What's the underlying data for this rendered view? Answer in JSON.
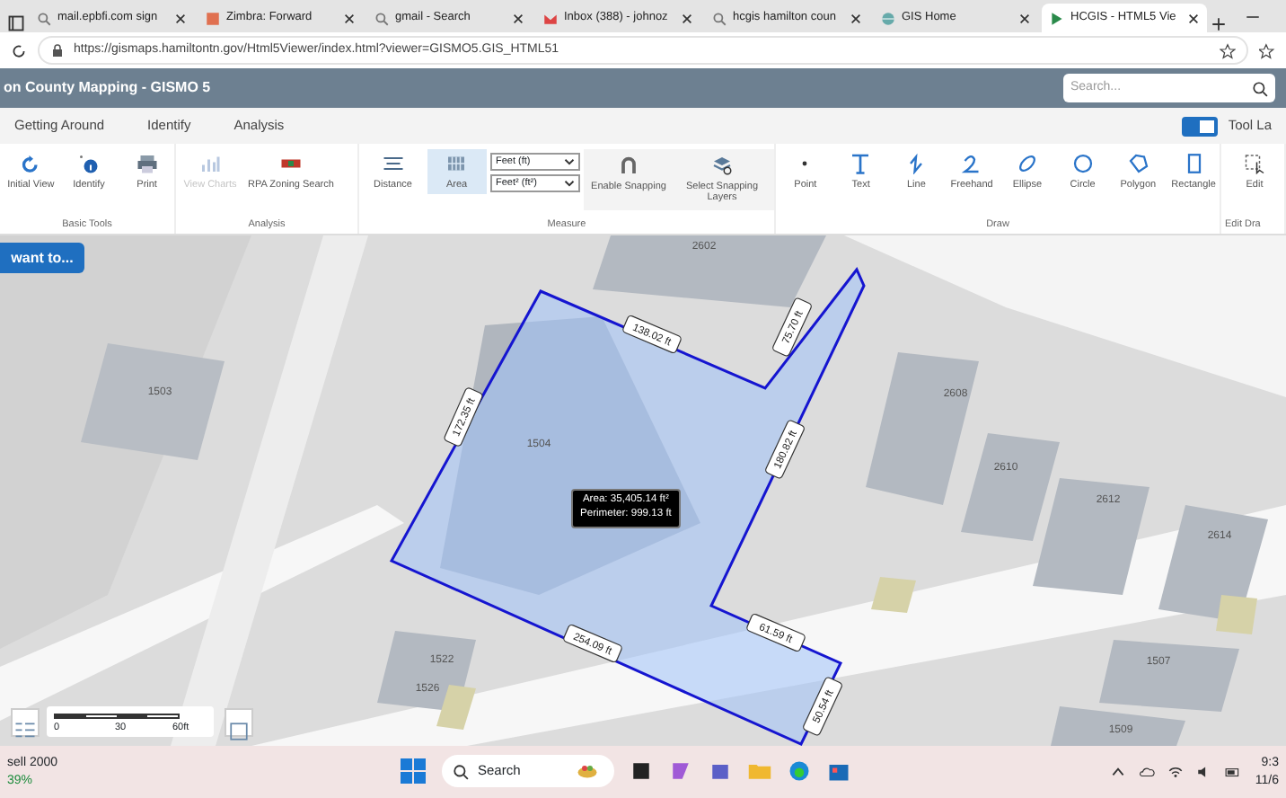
{
  "browser": {
    "tabs": [
      {
        "title": "mail.epbfi.com sign",
        "selected": false
      },
      {
        "title": "Zimbra: Forward",
        "selected": false
      },
      {
        "title": "gmail - Search",
        "selected": false
      },
      {
        "title": "Inbox (388) - johnoz",
        "selected": false
      },
      {
        "title": "hcgis hamilton coun",
        "selected": false
      },
      {
        "title": "GIS Home",
        "selected": false
      },
      {
        "title": "HCGIS - HTML5 Vie",
        "selected": true
      }
    ],
    "url": "https://gismaps.hamiltontn.gov/Html5Viewer/index.html?viewer=GISMO5.GIS_HTML51"
  },
  "app": {
    "title": "on County Mapping - GISMO 5",
    "search": {
      "placeholder": "Search..."
    }
  },
  "menu": {
    "tabs": [
      {
        "label": "Getting Around",
        "selected": false
      },
      {
        "label": "Identify",
        "selected": false
      },
      {
        "label": "Analysis",
        "selected": false
      }
    ],
    "toggle": {
      "label": "Tool La",
      "checked": true
    }
  },
  "ribbon": {
    "groups": [
      {
        "name": "Basic Tools",
        "tools": [
          {
            "label": "Initial View",
            "disabled": false,
            "selected": false
          },
          {
            "label": "Identify",
            "disabled": false,
            "selected": false
          },
          {
            "label": "Print",
            "disabled": false,
            "selected": false
          }
        ]
      },
      {
        "name": "Analysis",
        "tools": [
          {
            "label": "View Charts",
            "disabled": true,
            "selected": false
          },
          {
            "label": "RPA Zoning Search",
            "disabled": false,
            "selected": false
          }
        ]
      },
      {
        "name": "Measure",
        "tools": [
          {
            "label": "Distance",
            "disabled": false,
            "selected": false
          },
          {
            "label": "Area",
            "disabled": false,
            "selected": true
          }
        ],
        "selects": [
          "Feet (ft)",
          "Feet² (ft²)"
        ],
        "snapping": [
          {
            "label": "Enable Snapping"
          },
          {
            "label": "Select Snapping Layers"
          }
        ]
      },
      {
        "name": "Draw",
        "tools": [
          {
            "label": "Point",
            "disabled": false,
            "selected": false
          },
          {
            "label": "Text",
            "disabled": false,
            "selected": false
          },
          {
            "label": "Line",
            "disabled": false,
            "selected": false
          },
          {
            "label": "Freehand",
            "disabled": false,
            "selected": false
          },
          {
            "label": "Ellipse",
            "disabled": false,
            "selected": false
          },
          {
            "label": "Circle",
            "disabled": false,
            "selected": false
          },
          {
            "label": "Polygon",
            "disabled": false,
            "selected": false
          },
          {
            "label": "Rectangle",
            "disabled": false,
            "selected": false
          }
        ]
      },
      {
        "name": "Edit Dra",
        "tools": [
          {
            "label": "Edit",
            "disabled": false,
            "selected": false
          }
        ]
      }
    ]
  },
  "map": {
    "menu_button": "want to...",
    "parcels": [
      "2602",
      "1503",
      "2608",
      "1504",
      "2610",
      "2612",
      "2614",
      "1522",
      "1526",
      "1507",
      "1509"
    ],
    "measurements": [
      "138.02 ft",
      "75.70 ft",
      "172.35 ft",
      "180.82 ft",
      "61.59 ft",
      "254.09 ft",
      "50.54 ft"
    ],
    "tooltip": {
      "area": "Area: 35,405.14 ft²",
      "perimeter": "Perimeter: 999.13 ft"
    },
    "scale": [
      "0",
      "30",
      "60ft"
    ]
  },
  "taskbar": {
    "ticker": {
      "name": "sell 2000",
      "change": "39%"
    },
    "search": "Search",
    "clock": {
      "time": "9:3",
      "date": "11/6"
    }
  }
}
